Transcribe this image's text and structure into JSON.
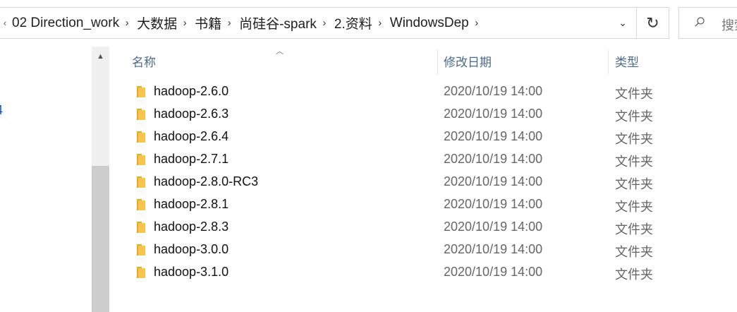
{
  "breadcrumb": {
    "lead_icon": "chevron-left-icon",
    "separator_icon": "chevron-right-icon",
    "items": [
      "02 Direction_work",
      "大数据",
      "书籍",
      "尚硅谷-spark",
      "2.资料",
      "WindowsDep"
    ]
  },
  "addressbar": {
    "dropdown_icon": "chevron-down-icon",
    "refresh_icon": "refresh-icon"
  },
  "search": {
    "placeholder": "搜索"
  },
  "navpane": {
    "fragment_text": "4"
  },
  "columns": {
    "name": "名称",
    "date": "修改日期",
    "type": "类型"
  },
  "files": [
    {
      "name": "hadoop-2.6.0",
      "date": "2020/10/19 14:00",
      "type": "文件夹"
    },
    {
      "name": "hadoop-2.6.3",
      "date": "2020/10/19 14:00",
      "type": "文件夹"
    },
    {
      "name": "hadoop-2.6.4",
      "date": "2020/10/19 14:00",
      "type": "文件夹"
    },
    {
      "name": "hadoop-2.7.1",
      "date": "2020/10/19 14:00",
      "type": "文件夹"
    },
    {
      "name": "hadoop-2.8.0-RC3",
      "date": "2020/10/19 14:00",
      "type": "文件夹"
    },
    {
      "name": "hadoop-2.8.1",
      "date": "2020/10/19 14:00",
      "type": "文件夹"
    },
    {
      "name": "hadoop-2.8.3",
      "date": "2020/10/19 14:00",
      "type": "文件夹"
    },
    {
      "name": "hadoop-3.0.0",
      "date": "2020/10/19 14:00",
      "type": "文件夹"
    },
    {
      "name": "hadoop-3.1.0",
      "date": "2020/10/19 14:00",
      "type": "文件夹"
    }
  ],
  "colors": {
    "folder_fill": "#f5c54e",
    "folder_tab": "#e6a823",
    "header_text": "#4d6b8a"
  }
}
